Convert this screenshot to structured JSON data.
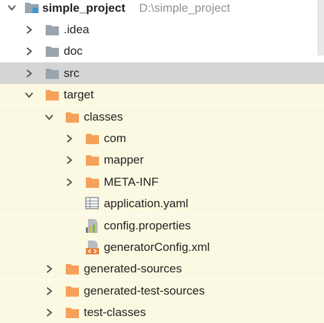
{
  "colors": {
    "excluded_background": "#fbf9e1",
    "selected_background": "#d5d5d5",
    "grey_folder": "#9aa4ad",
    "orange_folder": "#f5a15b",
    "text": "#222222",
    "path_text": "#909090"
  },
  "tree": {
    "root": {
      "label": "simple_project",
      "path": "D:\\simple_project",
      "icon": "module-folder-icon"
    },
    "items": [
      {
        "label": ".idea",
        "icon": "folder-icon",
        "chevron": "right",
        "level": 1,
        "state": "normal"
      },
      {
        "label": "doc",
        "icon": "folder-icon",
        "chevron": "right",
        "level": 1,
        "state": "normal"
      },
      {
        "label": "src",
        "icon": "folder-icon",
        "chevron": "right",
        "level": 1,
        "state": "selected"
      },
      {
        "label": "target",
        "icon": "excluded-folder-icon",
        "chevron": "down",
        "level": 1,
        "state": "excluded"
      },
      {
        "label": "classes",
        "icon": "excluded-folder-icon",
        "chevron": "down",
        "level": 2,
        "state": "excluded"
      },
      {
        "label": "com",
        "icon": "excluded-folder-icon",
        "chevron": "right",
        "level": 3,
        "state": "excluded"
      },
      {
        "label": "mapper",
        "icon": "excluded-folder-icon",
        "chevron": "right",
        "level": 3,
        "state": "excluded"
      },
      {
        "label": "META-INF",
        "icon": "excluded-folder-icon",
        "chevron": "right",
        "level": 3,
        "state": "excluded"
      },
      {
        "label": "application.yaml",
        "icon": "yaml-file-icon",
        "chevron": "none",
        "level": 3,
        "state": "excluded"
      },
      {
        "label": "config.properties",
        "icon": "properties-file-icon",
        "chevron": "none",
        "level": 3,
        "state": "excluded"
      },
      {
        "label": "generatorConfig.xml",
        "icon": "xml-file-icon",
        "chevron": "none",
        "level": 3,
        "state": "excluded"
      },
      {
        "label": "generated-sources",
        "icon": "excluded-folder-icon",
        "chevron": "right",
        "level": 2,
        "state": "excluded"
      },
      {
        "label": "generated-test-sources",
        "icon": "excluded-folder-icon",
        "chevron": "right",
        "level": 2,
        "state": "excluded"
      },
      {
        "label": "test-classes",
        "icon": "excluded-folder-icon",
        "chevron": "right",
        "level": 2,
        "state": "excluded"
      }
    ]
  }
}
